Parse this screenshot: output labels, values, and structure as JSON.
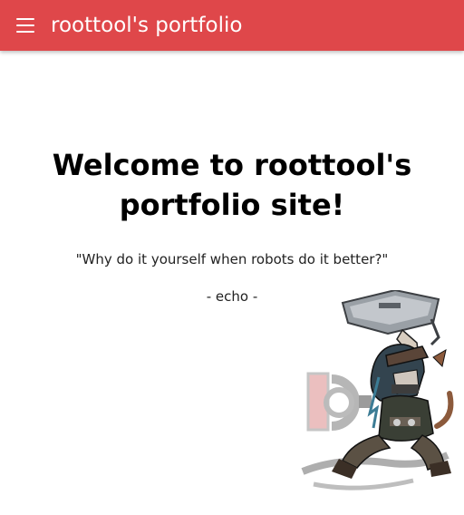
{
  "appbar": {
    "menu_icon": "menu-icon",
    "title": "roottool's portfolio",
    "color": "#df474a"
  },
  "main": {
    "heading_line1": "Welcome to roottool's",
    "heading_line2": "portfolio site!",
    "quote": "\"Why do it yourself when robots do it better?\"",
    "author": "- echo -"
  },
  "mascot": {
    "icon": "echo-mascot-illustration"
  }
}
